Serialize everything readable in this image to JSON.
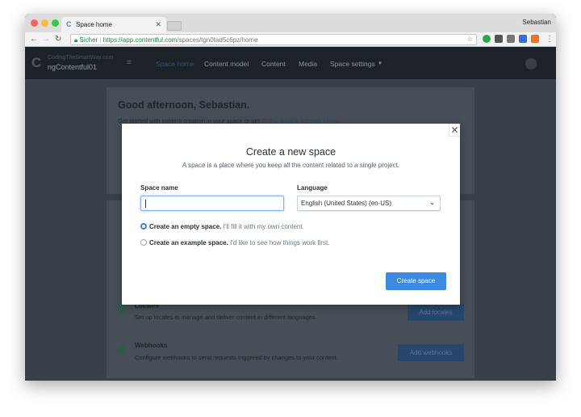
{
  "browser": {
    "tab_title": "Space home",
    "user": "Sebastian",
    "secure_label": "Sicher",
    "url_host": "https://app.contentful.com",
    "url_path": "/spaces/tgn0tad5c6pz/home"
  },
  "app": {
    "org": "CodingTheSmartWay.com",
    "space": "ngContentful01",
    "nav": [
      "Space home",
      "Content model",
      "Content",
      "Media",
      "Space settings"
    ]
  },
  "page": {
    "greeting": "Good afternoon, Sebastian.",
    "intro": "Get started with content creation in your space or get ",
    "intro_link": "SDKs, tools & tutorials below.",
    "items": [
      {
        "title": "Locales",
        "desc": "Set up locales to manage and deliver content in different languages.",
        "button": "Add locales"
      },
      {
        "title": "Webhooks",
        "desc": "Configure webhooks to send requests triggered by changes to your content.",
        "button": "Add webhooks"
      }
    ]
  },
  "modal": {
    "title": "Create a new space",
    "subtitle": "A space is a place where you keep all the content related to a single project.",
    "space_name_label": "Space name",
    "space_name_value": "",
    "language_label": "Language",
    "language_value": "English (United States) (en-US)",
    "option_empty": "Create an empty space.",
    "option_empty_desc": " I'll fill it with my own content.",
    "option_example": "Create an example space.",
    "option_example_desc": " I'd like to see how things work first.",
    "selected": "empty",
    "submit": "Create space"
  },
  "colors": {
    "accent": "#3d8ae2",
    "nav_bg": "#1d2228"
  }
}
